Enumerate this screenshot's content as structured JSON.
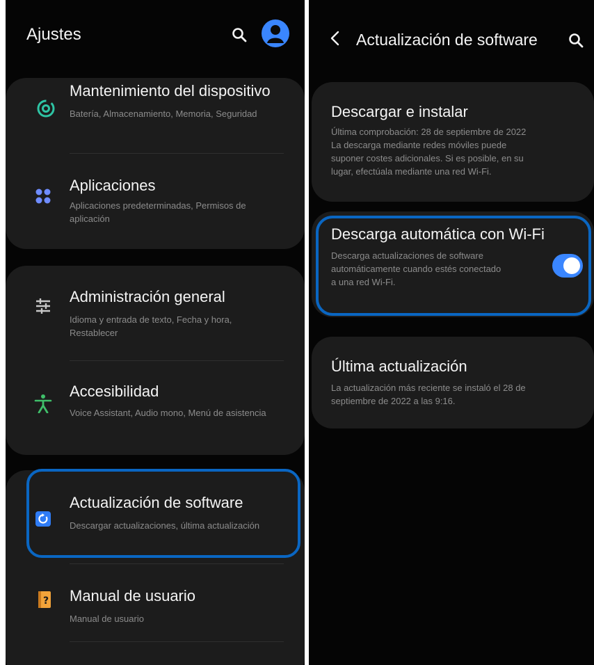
{
  "left_screen": {
    "title": "Ajustes",
    "search_icon": "search-icon",
    "avatar_icon": "account-icon",
    "items": [
      {
        "title": "Mantenimiento del dispositivo",
        "subtitle": "Batería, Almacenamiento, Memoria, Seguridad",
        "icon": "device-care-icon",
        "icon_color": "#2ec4a4"
      },
      {
        "title": "Aplicaciones",
        "subtitle": "Aplicaciones predeterminadas, Permisos de aplicación",
        "icon": "apps-icon",
        "icon_color": "#6f8cff"
      },
      {
        "title": "Administración general",
        "subtitle": "Idioma y entrada de texto, Fecha y hora, Restablecer",
        "icon": "sliders-icon",
        "icon_color": "#c8c8c8"
      },
      {
        "title": "Accesibilidad",
        "subtitle": "Voice Assistant, Audio mono, Menú de asistencia",
        "icon": "accessibility-icon",
        "icon_color": "#3fbf6a"
      },
      {
        "title": "Actualización de software",
        "subtitle": "Descargar actualizaciones, última actualización",
        "icon": "software-update-icon",
        "icon_color": "#2f7cf6"
      },
      {
        "title": "Manual de usuario",
        "subtitle": "Manual de usuario",
        "icon": "user-manual-icon",
        "icon_color": "#f2a33a"
      }
    ]
  },
  "right_screen": {
    "title": "Actualización de software",
    "back_icon": "back-arrow-icon",
    "search_icon": "search-icon",
    "download_install": {
      "title": "Descargar e instalar",
      "lines": [
        "Última comprobación: 28 de septiembre de 2022",
        "La descarga mediante redes móviles puede",
        "suponer costes adicionales. Si es posible, en su",
        "lugar, efectúala mediante una red Wi-Fi."
      ]
    },
    "auto_download": {
      "title": "Descarga automática con Wi-Fi",
      "lines": [
        "Descarga actualizaciones de software",
        "automáticamente cuando estés conectado",
        "a una red Wi-Fi."
      ],
      "toggle_on": true
    },
    "last_update": {
      "title": "Última actualización",
      "lines": [
        "La actualización más reciente se instaló el 28 de",
        "septiembre de 2022 a las 9:16."
      ]
    }
  },
  "colors": {
    "accent": "#3a86ff",
    "highlight": "#0a66c2",
    "background": "#050505",
    "card": "#1c1c1c"
  }
}
